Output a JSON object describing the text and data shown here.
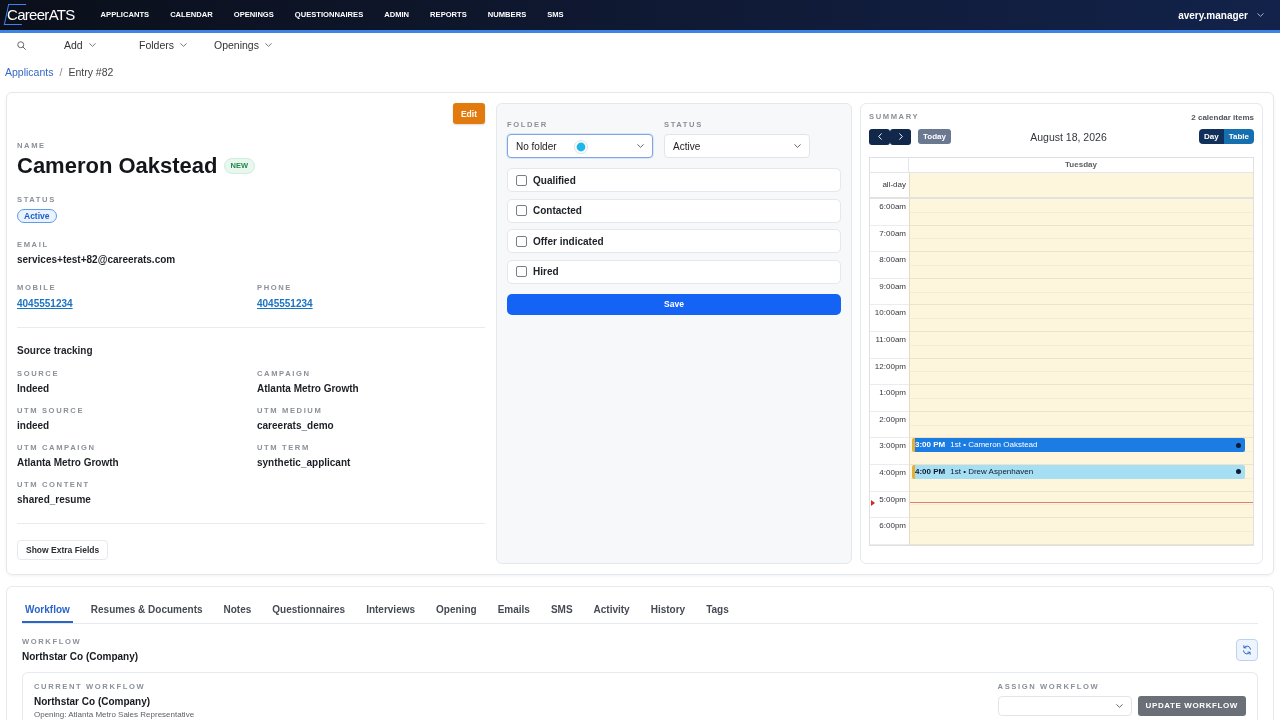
{
  "nav": {
    "logo": "CareerATS",
    "items": [
      {
        "label": "APPLICANTS"
      },
      {
        "label": "CALENDAR"
      },
      {
        "label": "OPENINGS"
      },
      {
        "label": "QUESTIONNAIRES"
      },
      {
        "label": "ADMIN"
      },
      {
        "label": "REPORTS"
      },
      {
        "label": "NUMBERS"
      },
      {
        "label": "SMS"
      }
    ],
    "user": "avery.manager"
  },
  "toolbar": {
    "menus": [
      {
        "label": "Add"
      },
      {
        "label": "Folders"
      },
      {
        "label": "Openings"
      }
    ]
  },
  "breadcrumb": {
    "link": "Applicants",
    "separator": "/",
    "current": "Entry #82"
  },
  "profile": {
    "edit_button": "Edit",
    "name_label": "NAME",
    "name": "Cameron Oakstead",
    "badge": "NEW",
    "status_label": "STATUS",
    "status": "Active",
    "email_label": "EMAIL",
    "email": "services+test+82@careerats.com",
    "contacts": [
      {
        "label": "MOBILE",
        "value": "4045551234"
      },
      {
        "label": "PHONE",
        "value": "4045551234"
      }
    ],
    "source_title": "Source tracking",
    "source_fields": [
      {
        "label": "SOURCE",
        "value": "Indeed"
      },
      {
        "label": "CAMPAIGN",
        "value": "Atlanta Metro Growth"
      },
      {
        "label": "UTM SOURCE",
        "value": "indeed"
      },
      {
        "label": "UTM MEDIUM",
        "value": "careerats_demo"
      },
      {
        "label": "UTM CAMPAIGN",
        "value": "Atlanta Metro Growth"
      },
      {
        "label": "UTM TERM",
        "value": "synthetic_applicant"
      },
      {
        "label": "UTM CONTENT",
        "value": "shared_resume"
      }
    ],
    "extra_button": "Show Extra Fields"
  },
  "pipeline": {
    "selects": [
      {
        "label": "FOLDER",
        "value": "No folder",
        "focused": true,
        "cursor": true
      },
      {
        "label": "STATUS",
        "value": "Active",
        "focused": false,
        "cursor": false
      }
    ],
    "checklist": [
      {
        "label": "Qualified",
        "checked": false
      },
      {
        "label": "Contacted",
        "checked": false
      },
      {
        "label": "Offer indicated",
        "checked": false
      },
      {
        "label": "Hired",
        "checked": false
      }
    ],
    "save_button": "Save"
  },
  "summary": {
    "title": "SUMMARY",
    "count": "2 calendar items",
    "today_button": "Today",
    "date": "August 18, 2026",
    "views": [
      {
        "label": "Day",
        "selected": true
      },
      {
        "label": "Table",
        "selected": false
      }
    ],
    "day_header": "Tuesday",
    "all_day_label": "all-day",
    "slots": [
      {
        "time": "6:00am",
        "now": false
      },
      {
        "time": "7:00am",
        "now": false
      },
      {
        "time": "8:00am",
        "now": false
      },
      {
        "time": "9:00am",
        "now": false
      },
      {
        "time": "10:00am",
        "now": false
      },
      {
        "time": "11:00am",
        "now": false
      },
      {
        "time": "12:00pm",
        "now": false
      },
      {
        "time": "1:00pm",
        "now": false
      },
      {
        "time": "2:00pm",
        "now": false
      },
      {
        "time": "3:00pm",
        "now": false,
        "events": [
          {
            "time": "3:00 PM",
            "title": "1st • Cameron Oakstead",
            "color": "#1b7ce4"
          }
        ]
      },
      {
        "time": "4:00pm",
        "now": false,
        "events": [
          {
            "time": "4:00 PM",
            "title": "1st • Drew Aspenhaven",
            "color": "#a6def4"
          }
        ]
      },
      {
        "time": "5:00pm",
        "now": true
      },
      {
        "time": "6:00pm",
        "now": false
      }
    ]
  },
  "details": {
    "tabs": [
      {
        "label": "Workflow",
        "selected": true
      },
      {
        "label": "Resumes & Documents",
        "selected": false
      },
      {
        "label": "Notes",
        "selected": false
      },
      {
        "label": "Questionnaires",
        "selected": false
      },
      {
        "label": "Interviews",
        "selected": false
      },
      {
        "label": "Opening",
        "selected": false
      },
      {
        "label": "Emails",
        "selected": false
      },
      {
        "label": "SMS",
        "selected": false
      },
      {
        "label": "Activity",
        "selected": false
      },
      {
        "label": "History",
        "selected": false
      },
      {
        "label": "Tags",
        "selected": false
      }
    ],
    "workflow_label": "WORKFLOW",
    "workflow": "Northstar Co (Company)",
    "current": {
      "label": "CURRENT WORKFLOW",
      "name": "Northstar Co (Company)",
      "opening": "Opening: Atlanta Metro Sales Representative"
    },
    "assign": {
      "label": "ASSIGN WORKFLOW",
      "button": "UPDATE WORKFLOW",
      "button_disabled": true
    }
  }
}
